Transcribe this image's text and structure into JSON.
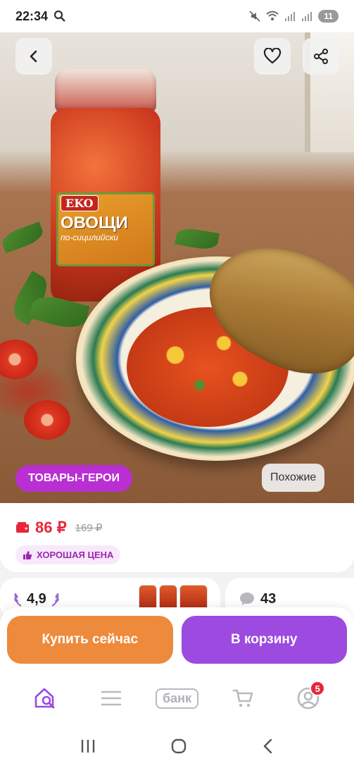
{
  "status_bar": {
    "time": "22:34",
    "notification_count": "11"
  },
  "hero": {
    "badge": "ТОВАРЫ-ГЕРОИ",
    "similar_label": "Похожие",
    "jar_brand": "EKO",
    "jar_title": "ОВОЩИ",
    "jar_subtitle": "по-сицилийски"
  },
  "price": {
    "current": "86 ₽",
    "old": "169 ₽",
    "good_price_label": "ХОРОШАЯ ЦЕНА",
    "accent_color": "#e8263b"
  },
  "rating": {
    "value": "4,9",
    "reviews_count": "43"
  },
  "actions": {
    "buy_now": "Купить сейчас",
    "add_to_cart": "В корзину",
    "buy_color": "#ee8a3c",
    "cart_color": "#9c4ae0"
  },
  "bottom_nav": {
    "items": [
      {
        "icon": "home-search-icon",
        "active": true
      },
      {
        "icon": "menu-icon"
      },
      {
        "icon": "bank-icon",
        "label": "банк"
      },
      {
        "icon": "cart-icon"
      },
      {
        "icon": "profile-icon",
        "badge": "5"
      }
    ]
  },
  "system_nav": {
    "icons": [
      "recents-icon",
      "home-icon",
      "back-icon"
    ]
  }
}
